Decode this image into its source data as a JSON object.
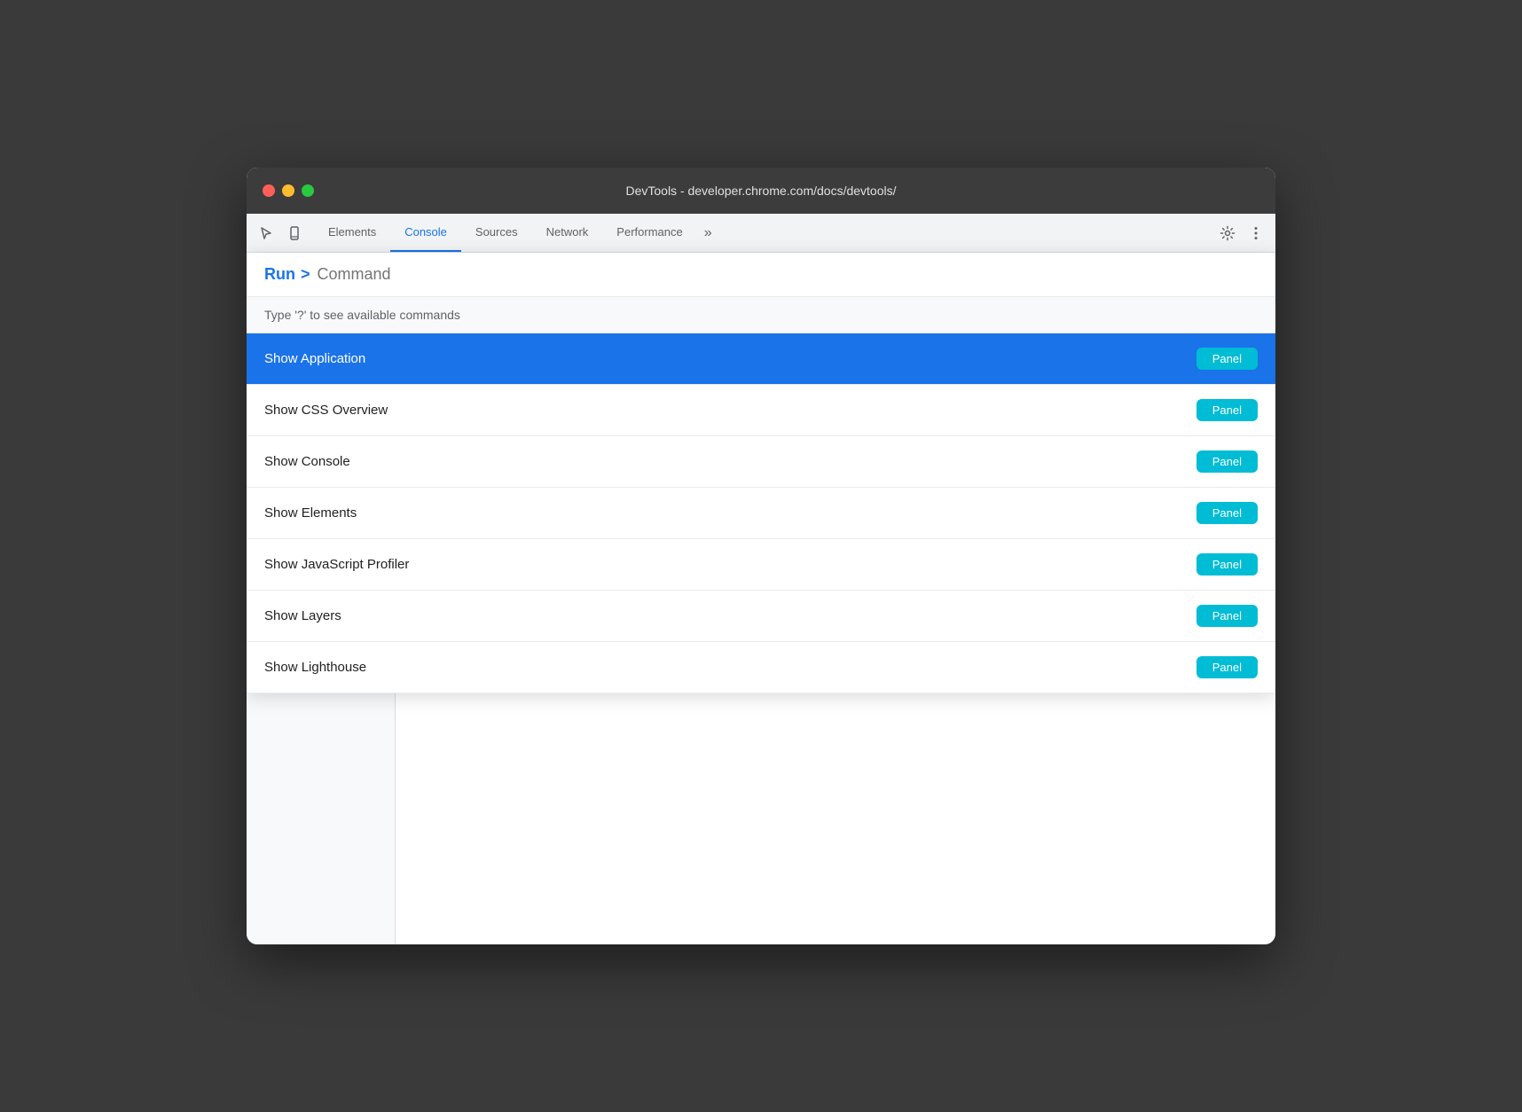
{
  "window": {
    "title": "DevTools - developer.chrome.com/docs/devtools/"
  },
  "tabs": {
    "items": [
      {
        "id": "elements",
        "label": "Elements",
        "active": false
      },
      {
        "id": "console",
        "label": "Console",
        "active": true
      },
      {
        "id": "sources",
        "label": "Sources",
        "active": false
      },
      {
        "id": "network",
        "label": "Network",
        "active": false
      },
      {
        "id": "performance",
        "label": "Performance",
        "active": false
      }
    ],
    "more_label": "»"
  },
  "command_menu": {
    "run_label": "Run",
    "chevron": ">",
    "input_placeholder": "Command",
    "hint_text": "Type '?' to see available commands",
    "items": [
      {
        "id": "show-application",
        "label": "Show Application",
        "badge": "Panel",
        "selected": true
      },
      {
        "id": "show-css-overview",
        "label": "Show CSS Overview",
        "badge": "Panel",
        "selected": false
      },
      {
        "id": "show-console",
        "label": "Show Console",
        "badge": "Panel",
        "selected": false
      },
      {
        "id": "show-elements",
        "label": "Show Elements",
        "badge": "Panel",
        "selected": false
      },
      {
        "id": "show-javascript-profiler",
        "label": "Show JavaScript Profiler",
        "badge": "Panel",
        "selected": false
      },
      {
        "id": "show-layers",
        "label": "Show Layers",
        "badge": "Panel",
        "selected": false
      },
      {
        "id": "show-lighthouse",
        "label": "Show Lighthouse",
        "badge": "Panel",
        "selected": false
      }
    ]
  },
  "colors": {
    "accent_blue": "#1a73e8",
    "accent_cyan": "#00bcd4",
    "selected_bg": "#1a73e8",
    "tab_active_color": "#1a73e8"
  },
  "icons": {
    "cursor": "⬡",
    "mobile": "⊟",
    "settings": "⚙",
    "more_vertical": "⋮",
    "panel_toggle": "▣",
    "no_entry": "⊘",
    "chevron_right": "›"
  }
}
